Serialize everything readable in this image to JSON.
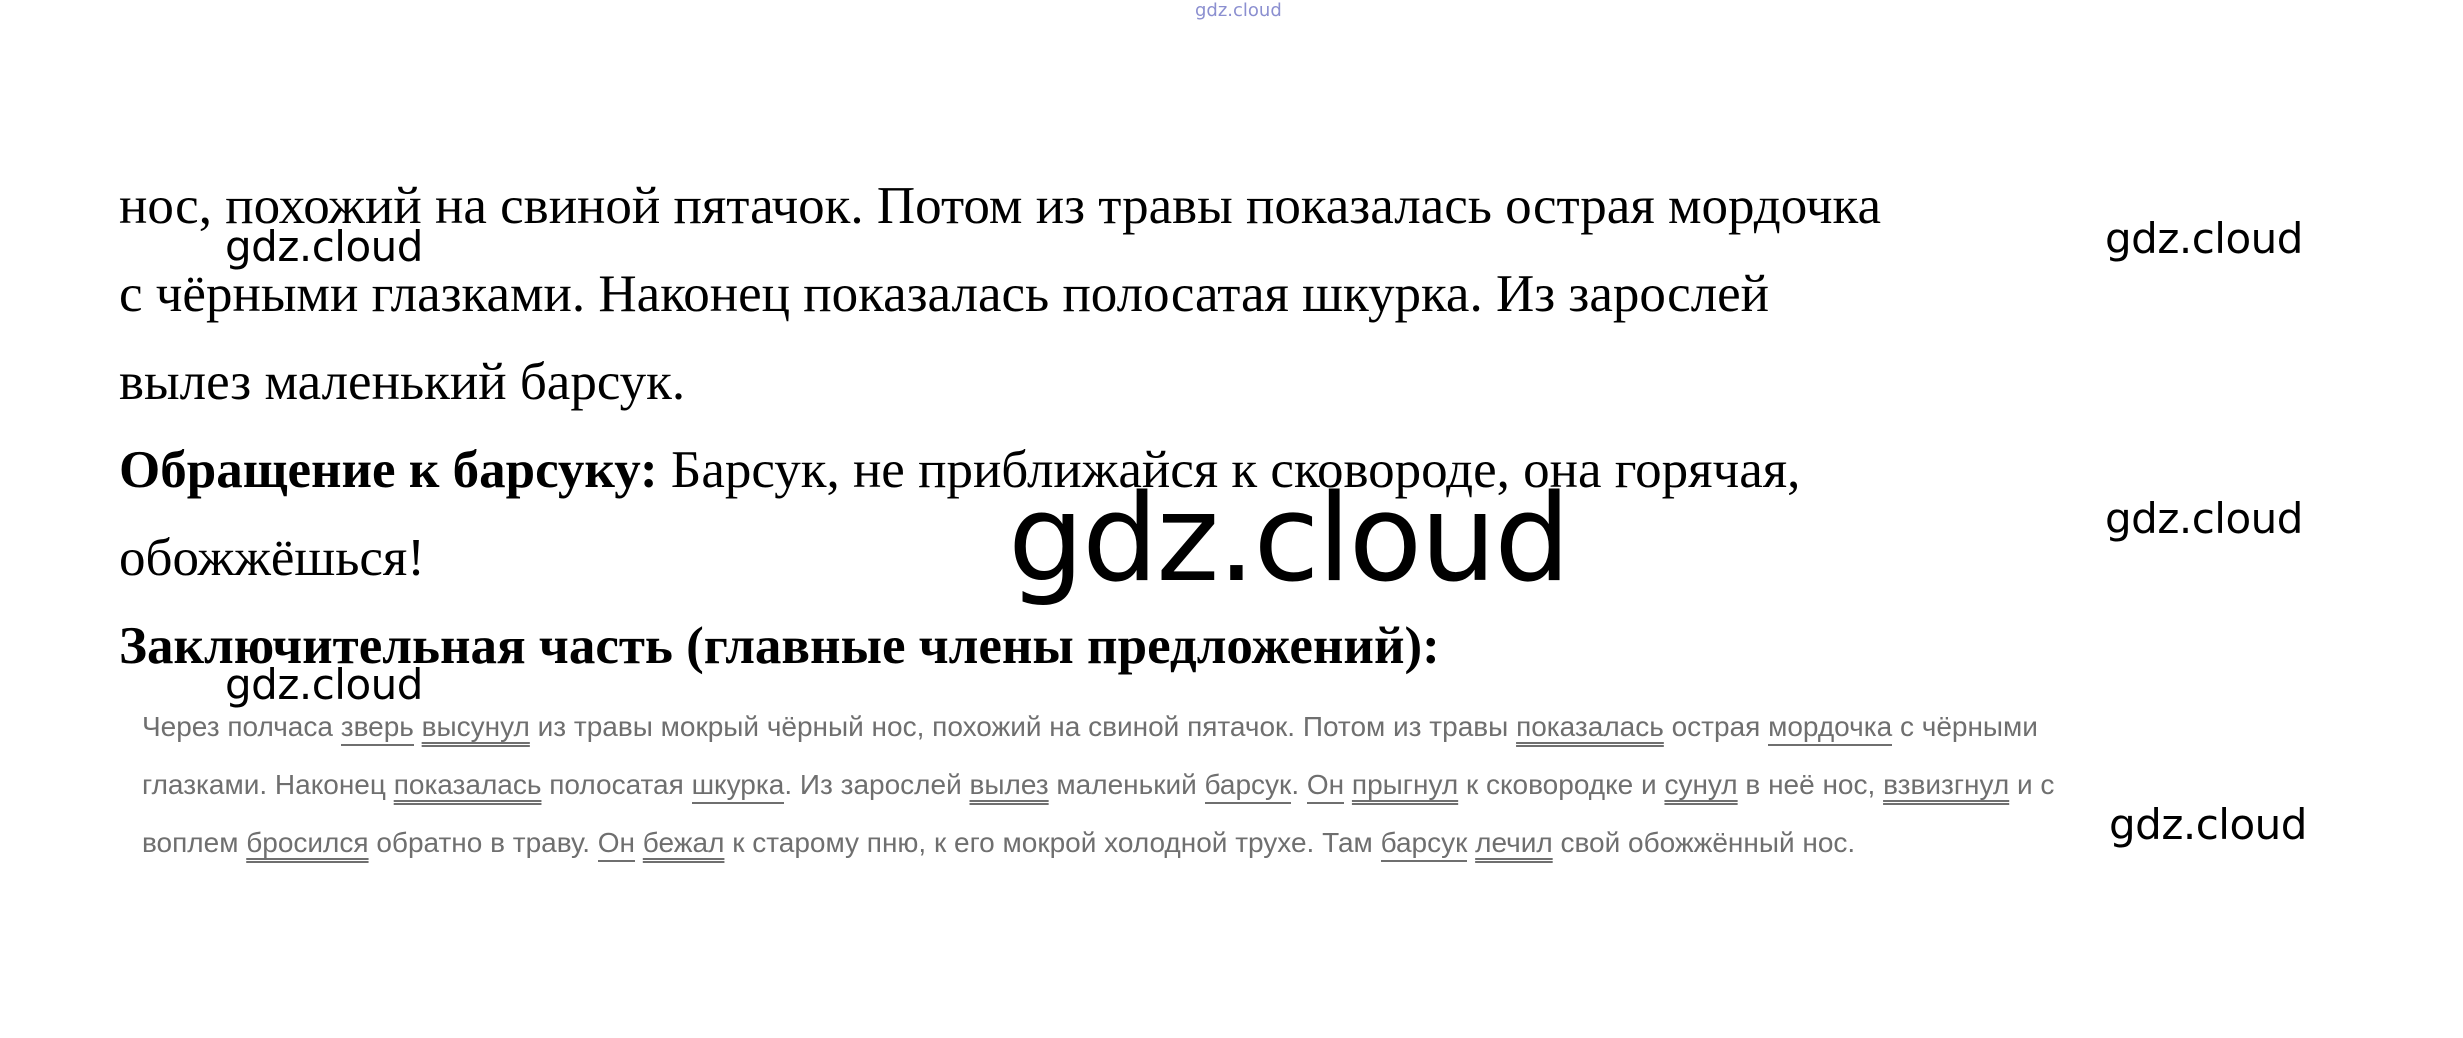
{
  "top_watermark": "gdz.cloud",
  "paragraph": {
    "line1": "нос, похожий на свиной пятачок. Потом из травы показалась острая мордочка",
    "line2": "с чёрными глазками. Наконец показалась полосатая шкурка. Из зарослей",
    "line3": "вылез маленький барсук.",
    "address_label": "Обращение к барсуку:",
    "address_text": " Барсук, не приближайся к сковороде, она горячая,",
    "line5": "обожжёшься!",
    "final_heading": "Заключительная часть (главные члены предложений):"
  },
  "quote": {
    "l1": [
      {
        "t": "Через полчаса ",
        "u": ""
      },
      {
        "t": "зверь",
        "u": "single"
      },
      {
        "t": " ",
        "u": ""
      },
      {
        "t": "высунул",
        "u": "double"
      },
      {
        "t": " из травы мокрый чёрный нос, похожий на свиной пятачок. Потом из травы ",
        "u": ""
      },
      {
        "t": "показалась",
        "u": "double"
      },
      {
        "t": " острая ",
        "u": ""
      },
      {
        "t": "мордочка",
        "u": "single"
      },
      {
        "t": " с чёрными",
        "u": ""
      }
    ],
    "l2": [
      {
        "t": "глазками. Наконец ",
        "u": ""
      },
      {
        "t": "показалась",
        "u": "double"
      },
      {
        "t": " полосатая ",
        "u": ""
      },
      {
        "t": "шкурка",
        "u": "single"
      },
      {
        "t": ". Из зарослей ",
        "u": ""
      },
      {
        "t": "вылез",
        "u": "double"
      },
      {
        "t": " маленький ",
        "u": ""
      },
      {
        "t": "барсук",
        "u": "single"
      },
      {
        "t": ". ",
        "u": ""
      },
      {
        "t": "Он",
        "u": "single"
      },
      {
        "t": " ",
        "u": ""
      },
      {
        "t": "прыгнул",
        "u": "double"
      },
      {
        "t": " к сковородке и ",
        "u": ""
      },
      {
        "t": "сунул",
        "u": "double"
      },
      {
        "t": " в неё нос, ",
        "u": ""
      },
      {
        "t": "взвизгнул",
        "u": "double"
      },
      {
        "t": " и с",
        "u": ""
      }
    ],
    "l3": [
      {
        "t": "воплем ",
        "u": ""
      },
      {
        "t": "бросился",
        "u": "double"
      },
      {
        "t": " обратно в траву. ",
        "u": ""
      },
      {
        "t": "Он",
        "u": "single"
      },
      {
        "t": " ",
        "u": ""
      },
      {
        "t": "бежал",
        "u": "double"
      },
      {
        "t": " к старому пню, к его мокрой холодной трухе. Там ",
        "u": ""
      },
      {
        "t": "барсук",
        "u": "single"
      },
      {
        "t": " ",
        "u": ""
      },
      {
        "t": "лечил",
        "u": "double"
      },
      {
        "t": " свой обожжённый нос.",
        "u": ""
      }
    ]
  },
  "watermarks": {
    "w1": "gdz.cloud",
    "w2": "gdz.cloud",
    "w3": "gdz.cloud",
    "w4": "gdz.cloud",
    "w5": "gdz.cloud",
    "w6": "gdz.cloud",
    "big": "gdz.cloud"
  }
}
